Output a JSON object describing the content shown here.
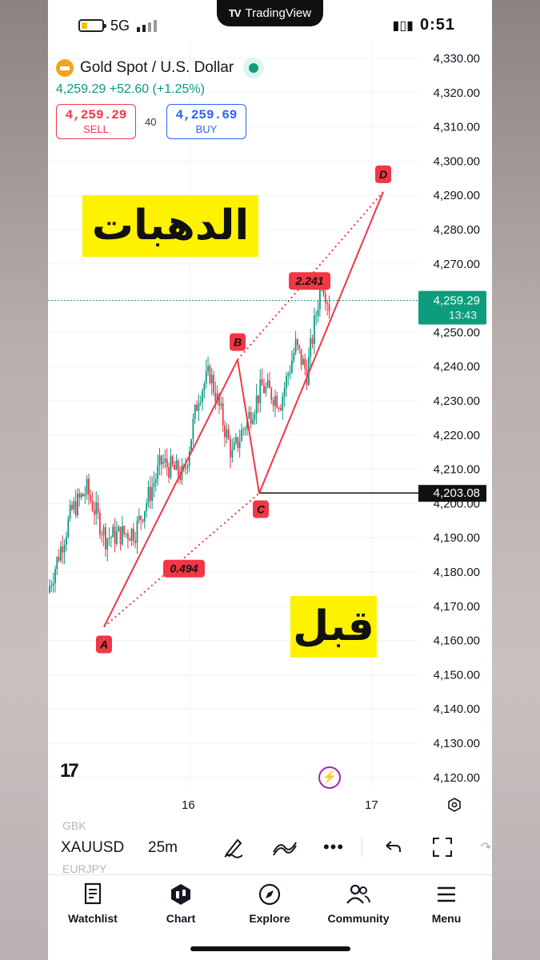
{
  "status_bar": {
    "network": "5G",
    "time": "0:51",
    "pill_brand": "TradingView"
  },
  "symbol": {
    "name": "Gold Spot / U.S. Dollar",
    "last_line": "4,259.29  +52.60 (+1.25%)",
    "sell_price": "4,259.29",
    "sell_label": "SELL",
    "buy_price": "4,259.69",
    "buy_label": "BUY",
    "spread": "40"
  },
  "price_scale": {
    "ticks": [
      "4,330.00",
      "4,320.00",
      "4,310.00",
      "4,300.00",
      "4,290.00",
      "4,280.00",
      "4,270.00",
      "4,260.00",
      "4,250.00",
      "4,240.00",
      "4,230.00",
      "4,220.00",
      "4,210.00",
      "4,200.00",
      "4,190.00",
      "4,180.00",
      "4,170.00",
      "4,160.00",
      "4,150.00",
      "4,140.00",
      "4,130.00",
      "4,120.00"
    ],
    "current_price": "4,259.29",
    "countdown": "13:43",
    "level_label": "4,203.08"
  },
  "time_axis": {
    "labels": [
      "16",
      "17"
    ]
  },
  "pattern": {
    "points": [
      "A",
      "B",
      "C",
      "D"
    ],
    "ratio_xab": "0.494",
    "ratio_bcd": "2.241"
  },
  "annotations": {
    "text_top": "الدهبات",
    "text_bottom": "قبل"
  },
  "chart_data": {
    "type": "candlestick",
    "symbol": "XAUUSD",
    "interval": "25m",
    "y_range": [
      4115,
      4335
    ],
    "last_price": 4259.29,
    "horizontal_level": 4203.08,
    "pattern_points": [
      {
        "label": "A",
        "price": 4164
      },
      {
        "label": "B",
        "price": 4242
      },
      {
        "label": "C",
        "price": 4203
      },
      {
        "label": "D",
        "price": 4291
      }
    ]
  },
  "toolbar": {
    "ghost_top": "GBK",
    "symbol": "XAUUSD",
    "ghost_bottom": "EURJPY",
    "interval": "25m"
  },
  "nav": {
    "watchlist": "Watchlist",
    "chart": "Chart",
    "explore": "Explore",
    "community": "Community",
    "menu": "Menu"
  },
  "colors": {
    "up": "#089981",
    "down": "#f23645",
    "pattern": "#f23645",
    "accent": "#2962ff"
  }
}
